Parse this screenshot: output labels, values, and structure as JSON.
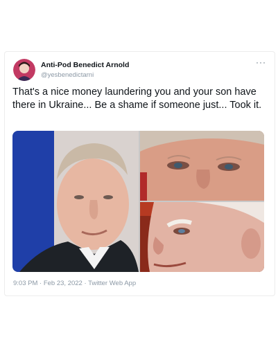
{
  "tweet": {
    "display_name": "Anti-Pod Benedict Arnold",
    "handle": "@yesbenedictarni",
    "more_icon": "more-horizontal-icon",
    "text": "That's a nice money laundering you and your son have there in Ukraine... Be a shame if someone just... Took it.",
    "time": "9:03 PM",
    "separator": "·",
    "date": "Feb 23, 2022",
    "source": "Twitter Web App"
  },
  "colors": {
    "secondary_text": "#8b98a5",
    "card_border": "#ececec",
    "flag_blue": "#1f3fa8"
  }
}
